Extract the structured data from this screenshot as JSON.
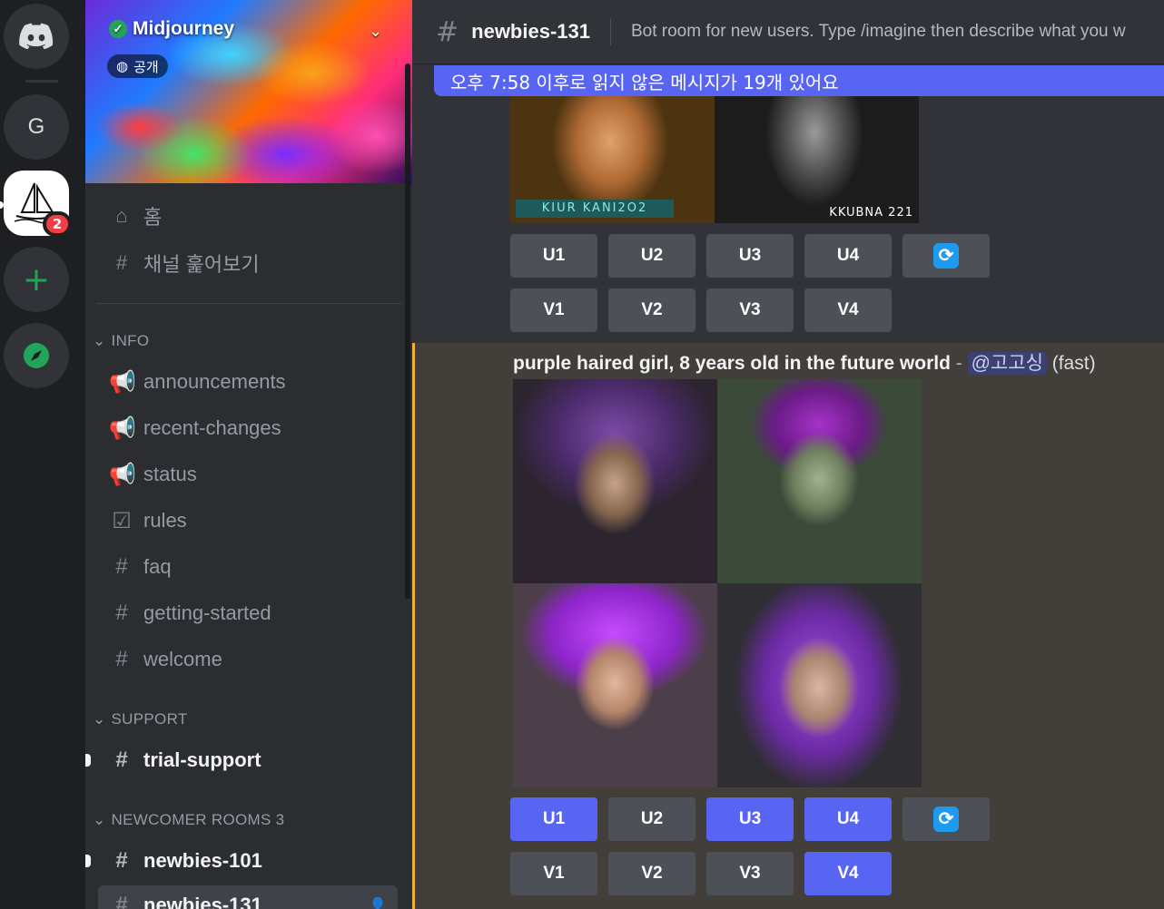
{
  "servers": {
    "guild_letter": "G",
    "midjourney_badge": "2"
  },
  "sidebar": {
    "server_name": "Midjourney",
    "public_label": "공개",
    "nav": [
      {
        "label": "홈",
        "icon": "home-icon"
      },
      {
        "label": "채널 훑어보기",
        "icon": "channel-browse-icon"
      }
    ],
    "categories": [
      {
        "label": "INFO",
        "channels": [
          {
            "name": "announcements",
            "icon": "megaphone-icon"
          },
          {
            "name": "recent-changes",
            "icon": "megaphone-icon"
          },
          {
            "name": "status",
            "icon": "megaphone-icon"
          },
          {
            "name": "rules",
            "icon": "rules-checkbox-icon"
          },
          {
            "name": "faq",
            "icon": "hash-icon"
          },
          {
            "name": "getting-started",
            "icon": "hash-icon"
          },
          {
            "name": "welcome",
            "icon": "hash-icon"
          }
        ]
      },
      {
        "label": "SUPPORT",
        "channels": [
          {
            "name": "trial-support",
            "icon": "hash-icon",
            "unread": true
          }
        ]
      },
      {
        "label": "NEWCOMER ROOMS 3",
        "channels": [
          {
            "name": "newbies-101",
            "icon": "hash-thread-icon",
            "unread": true
          },
          {
            "name": "newbies-131",
            "icon": "hash-thread-icon",
            "active": true
          }
        ]
      }
    ]
  },
  "header": {
    "channel_name": "newbies-131",
    "topic": "Bot room for new users. Type /imagine then describe what you w"
  },
  "new_messages_bar": "오후 7:58 이후로 읽지 않은 메시지가 19개 있어요",
  "message1": {
    "watermark_left": "KIUR KANI2O2",
    "watermark_right": "KKUBNA 221",
    "upscale_buttons": [
      "U1",
      "U2",
      "U3",
      "U4"
    ],
    "variation_buttons": [
      "V1",
      "V2",
      "V3",
      "V4"
    ]
  },
  "message2": {
    "prompt": "purple haired girl, 8 years old in the future world",
    "separator": "-",
    "mention": "@고고싱",
    "speed": "(fast)",
    "upscale_buttons": [
      "U1",
      "U2",
      "U3",
      "U4"
    ],
    "variation_buttons": [
      "V1",
      "V2",
      "V3",
      "V4"
    ],
    "upscale_selected": [
      true,
      false,
      true,
      true
    ],
    "variation_selected": [
      false,
      false,
      false,
      true
    ]
  },
  "colors": {
    "accent": "#5865f2",
    "unread_highlight": "#f0b232",
    "badge": "#f23f43",
    "online_green": "#23a559"
  }
}
